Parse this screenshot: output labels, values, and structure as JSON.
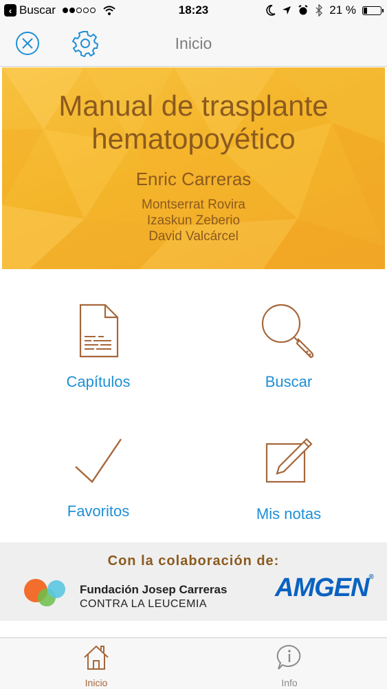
{
  "status_bar": {
    "back_app": "Buscar",
    "time": "18:23",
    "battery": "21 %",
    "battery_level": 0.21
  },
  "nav": {
    "title": "Inicio",
    "close_icon": "close-circle-icon",
    "settings_icon": "gear-icon"
  },
  "banner": {
    "title_line1": "Manual de trasplante",
    "title_line2": "hematopoyético",
    "author": "Enric Carreras",
    "coauthors": [
      "Montserrat Rovira",
      "Izaskun Zeberio",
      "David Valcárcel"
    ],
    "colors": {
      "bg": "#f4b52a",
      "text": "#8b5a1e"
    }
  },
  "menu": [
    {
      "label": "Capítulos",
      "icon": "document-icon"
    },
    {
      "label": "Buscar",
      "icon": "magnifier-icon"
    },
    {
      "label": "Favoritos",
      "icon": "checkmark-icon"
    },
    {
      "label": "Mis notas",
      "icon": "notepad-pencil-icon"
    }
  ],
  "collab": {
    "title": "Con la colaboración de:",
    "foundation_name": "Fundación Josep Carreras",
    "foundation_sub": "CONTRA LA LEUCEMIA",
    "sponsor": "AMGEN",
    "sponsor_mark": "®"
  },
  "tabs": [
    {
      "label": "Inicio",
      "icon": "home-icon",
      "active": true
    },
    {
      "label": "Info",
      "icon": "info-bubble-icon",
      "active": false
    }
  ],
  "colors": {
    "accent": "#1e8fd6",
    "brown": "#a5663a",
    "bar_bg": "#f7f7f7"
  }
}
